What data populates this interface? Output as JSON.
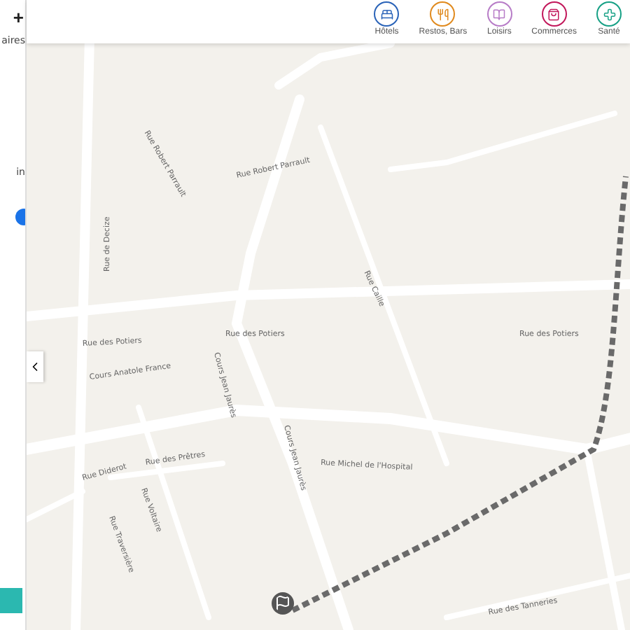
{
  "sidebar": {
    "zoom_in": "+",
    "label_1": "aires",
    "label_2": "in"
  },
  "categories": [
    {
      "label": "Hôtels",
      "color": "#2a63b8",
      "kind": "bed"
    },
    {
      "label": "Restos, Bars",
      "color": "#e08a1e",
      "kind": "fork"
    },
    {
      "label": "Loisirs",
      "color": "#b77cc7",
      "kind": "book"
    },
    {
      "label": "Commerces",
      "color": "#c2185b",
      "kind": "bag"
    },
    {
      "label": "Santé",
      "color": "#16a085",
      "kind": "cross"
    }
  ],
  "streets": [
    "Rue de Decize",
    "Rue des Potiers",
    "Cours Anatole France",
    "Rue Robert Parrault",
    "Rue Robert Parrault",
    "Rue Caille",
    "Rue des Potiers",
    "Rue des Potiers",
    "Rue Diderot",
    "Rue des Prêtres",
    "Rue Michel de l'Hospital",
    "Cours Jean Jaurès",
    "Cours Jean Jaurès",
    "Rue Voltaire",
    "Rue Traversière",
    "Rue des Tanneries"
  ]
}
